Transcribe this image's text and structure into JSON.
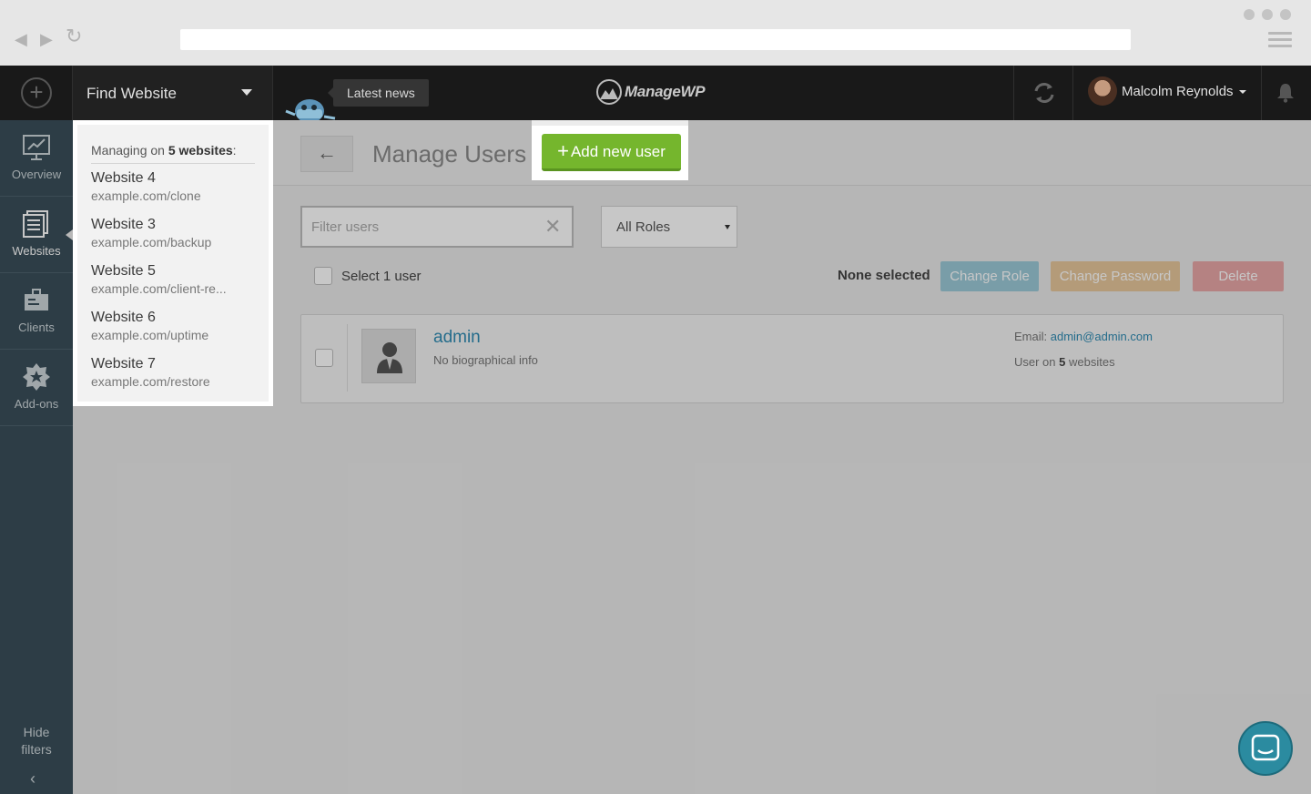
{
  "browser": {
    "back_icon": "back-arrow-icon",
    "forward_icon": "forward-arrow-icon",
    "reload_icon": "reload-icon",
    "menu_icon": "hamburger-icon"
  },
  "topbar": {
    "find_website_label": "Find Website",
    "news_label": "Latest news",
    "logo_text": "ManageWP",
    "user_name": "Malcolm Reynolds"
  },
  "sidebar": {
    "items": [
      {
        "label": "Overview",
        "icon": "chart-icon"
      },
      {
        "label": "Websites",
        "icon": "websites-icon"
      },
      {
        "label": "Clients",
        "icon": "briefcase-icon"
      },
      {
        "label": "Add-ons",
        "icon": "star-badge-icon"
      }
    ],
    "hide_filters_line1": "Hide",
    "hide_filters_line2": "filters"
  },
  "sites_panel": {
    "managing_prefix": "Managing on",
    "managing_count": "5 websites",
    "managing_suffix": ":",
    "sites": [
      {
        "name": "Website 4",
        "url": "example.com/clone"
      },
      {
        "name": "Website 3",
        "url": "example.com/backup"
      },
      {
        "name": "Website 5",
        "url": "example.com/client-re..."
      },
      {
        "name": "Website 6",
        "url": "example.com/uptime"
      },
      {
        "name": "Website 7",
        "url": "example.com/restore"
      }
    ]
  },
  "main": {
    "title": "Manage Users",
    "add_user_label": "Add new user",
    "filter_placeholder": "Filter users",
    "filter_value": "",
    "roles_selected": "All Roles",
    "select_label": "Select 1 user",
    "none_selected": "None selected",
    "actions": {
      "change_role": "Change Role",
      "change_password": "Change Password",
      "delete": "Delete"
    },
    "user": {
      "name": "admin",
      "bio": "No biographical info",
      "email_label": "Email:",
      "email": "admin@admin.com",
      "sites_prefix": "User on",
      "sites_count": "5",
      "sites_suffix": "websites"
    }
  },
  "colors": {
    "accent_green": "#75b62d",
    "change_role": "#9cc9d8",
    "change_password": "#e7c79c",
    "delete": "#e8a7a7",
    "sidebar": "#3a4f5a",
    "link": "#2f8bb3"
  }
}
